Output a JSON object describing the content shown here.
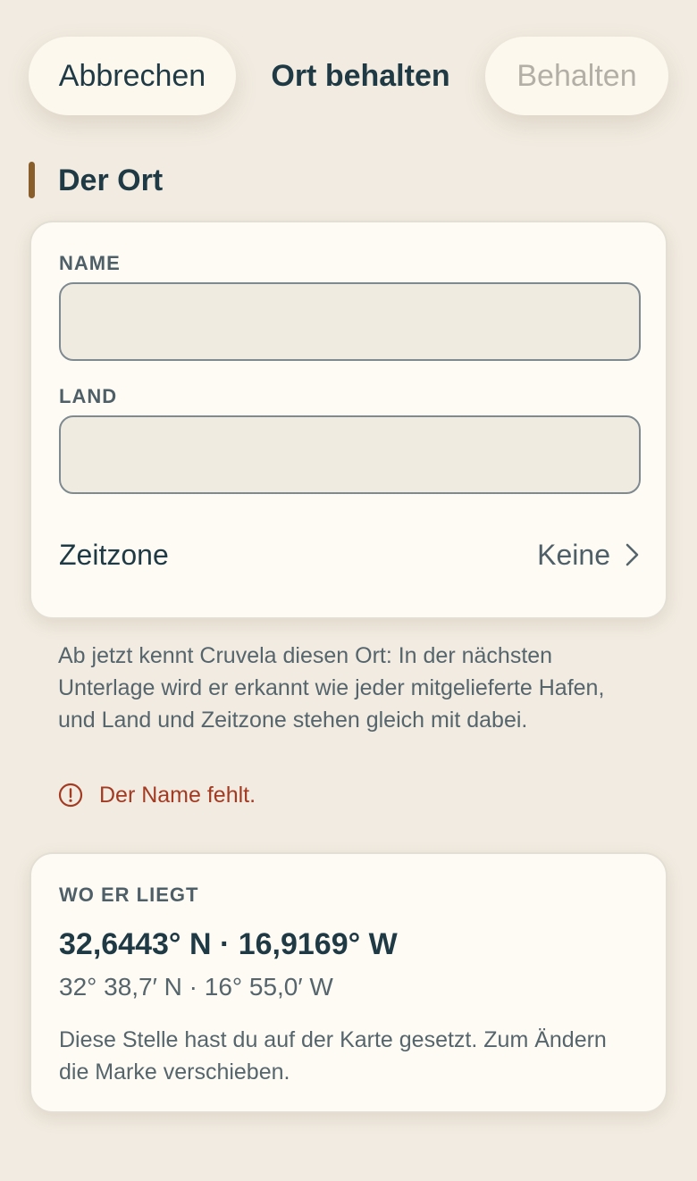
{
  "header": {
    "cancel_label": "Abbrechen",
    "title": "Ort behalten",
    "save_label": "Behalten"
  },
  "section": {
    "title": "Der Ort"
  },
  "place_card": {
    "name_label": "NAME",
    "name_value": "",
    "country_label": "LAND",
    "country_value": "",
    "timezone_label": "Zeitzone",
    "timezone_value": "Keine"
  },
  "help_text": "Ab jetzt kennt Cruvela diesen Ort: In der nächsten Unterlage wird er erkannt wie jeder mitgelieferte Hafen, und Land und Zeitzone stehen gleich mit dabei.",
  "error": {
    "icon": "alert-circle-icon",
    "text": "Der Name fehlt.",
    "color": "#A33A22"
  },
  "location_card": {
    "label": "WO ER LIEGT",
    "coords_decimal": "32,6443° N · 16,9169° W",
    "coords_dm": "32° 38,7′ N · 16° 55,0′ W",
    "note": "Diese Stelle hast du auf der Karte gesetzt. Zum Ändern die Marke verschieben."
  },
  "colors": {
    "background": "#F1EBE1",
    "card": "#FEFBF4",
    "accent_bar": "#8A5E2B",
    "text": "#1F3A44",
    "disabled": "#B3AFA6"
  }
}
